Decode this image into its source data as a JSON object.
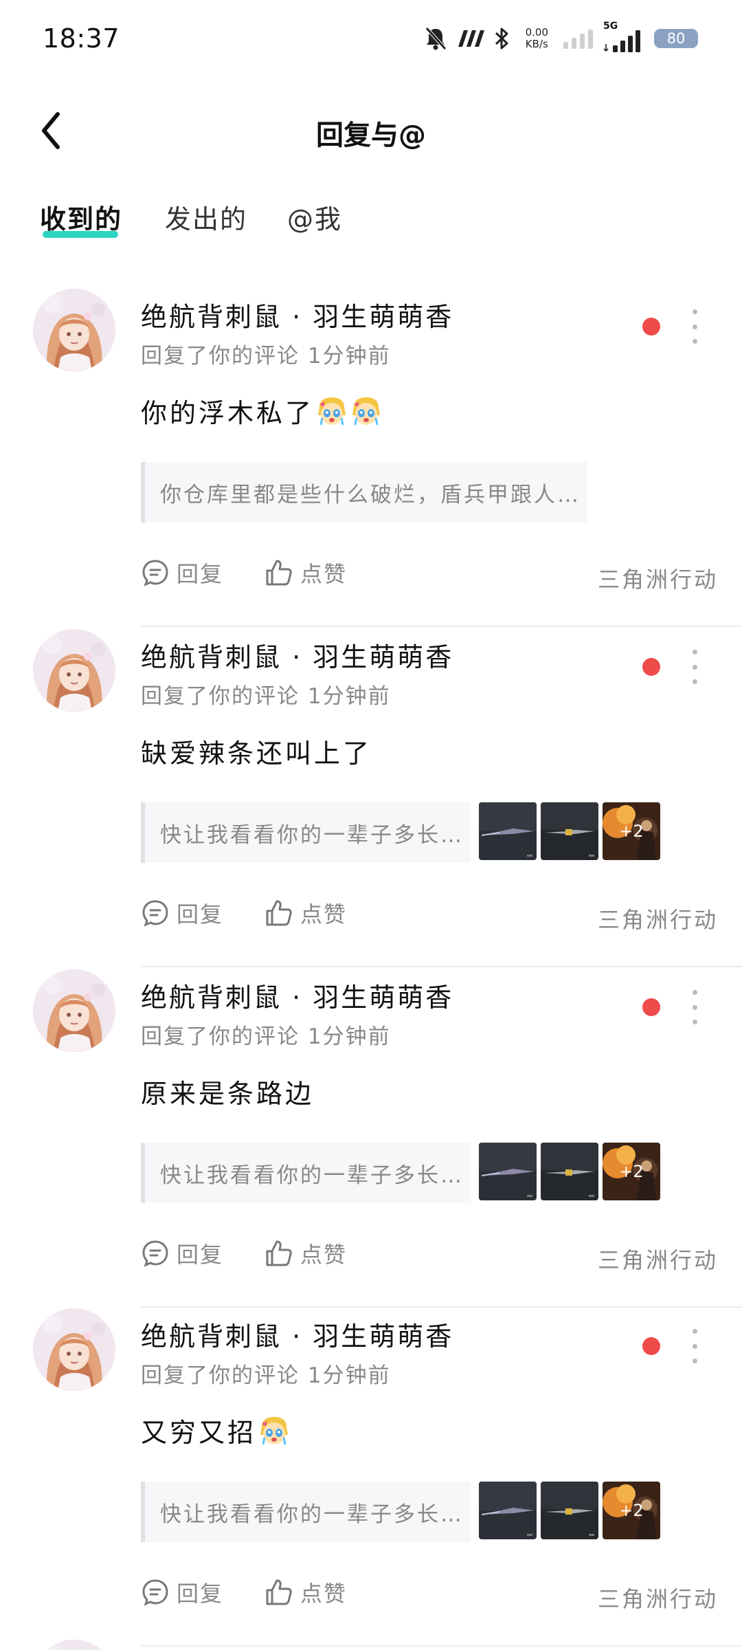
{
  "status_bar": {
    "time": "18:37",
    "net_speed_value": "0.00",
    "net_speed_unit": "KB/s",
    "network_type": "5G",
    "battery": "80"
  },
  "header": {
    "title": "回复与@"
  },
  "tabs": [
    {
      "label": "收到的",
      "active": true
    },
    {
      "label": "发出的",
      "active": false
    },
    {
      "label": "@我",
      "active": false
    }
  ],
  "messages": [
    {
      "username": "绝航背刺鼠 · 羽生萌萌香",
      "meta": "回复了你的评论 1分钟前",
      "reply_text": "你的浮木私了",
      "emoji_count": 2,
      "quote": "你仓库里都是些什么破烂，盾兵甲跟人机头是…",
      "has_thumbs": false,
      "reply_label": "回复",
      "like_label": "点赞",
      "game": "三角洲行动"
    },
    {
      "username": "绝航背刺鼠 · 羽生萌萌香",
      "meta": "回复了你的评论 1分钟前",
      "reply_text": "缺爱辣条还叫上了",
      "emoji_count": 0,
      "quote": "快让我看看你的一辈子多长…",
      "has_thumbs": true,
      "more_count": "+2",
      "reply_label": "回复",
      "like_label": "点赞",
      "game": "三角洲行动"
    },
    {
      "username": "绝航背刺鼠 · 羽生萌萌香",
      "meta": "回复了你的评论 1分钟前",
      "reply_text": "原来是条路边",
      "emoji_count": 0,
      "quote": "快让我看看你的一辈子多长…",
      "has_thumbs": true,
      "more_count": "+2",
      "reply_label": "回复",
      "like_label": "点赞",
      "game": "三角洲行动"
    },
    {
      "username": "绝航背刺鼠 · 羽生萌萌香",
      "meta": "回复了你的评论 1分钟前",
      "reply_text": "又穷又招",
      "emoji_count": 1,
      "quote": "快让我看看你的一辈子多长…",
      "has_thumbs": true,
      "more_count": "+2",
      "reply_label": "回复",
      "like_label": "点赞",
      "game": "三角洲行动"
    }
  ],
  "colors": {
    "accent_underline": "#2ed3c0",
    "unread_dot": "#f04b4b",
    "muted_text": "#888888"
  },
  "icons": {
    "back": "chevron-left-icon",
    "reply": "comment-bubble-icon",
    "like": "thumbs-up-icon",
    "more": "vertical-dots-icon"
  }
}
